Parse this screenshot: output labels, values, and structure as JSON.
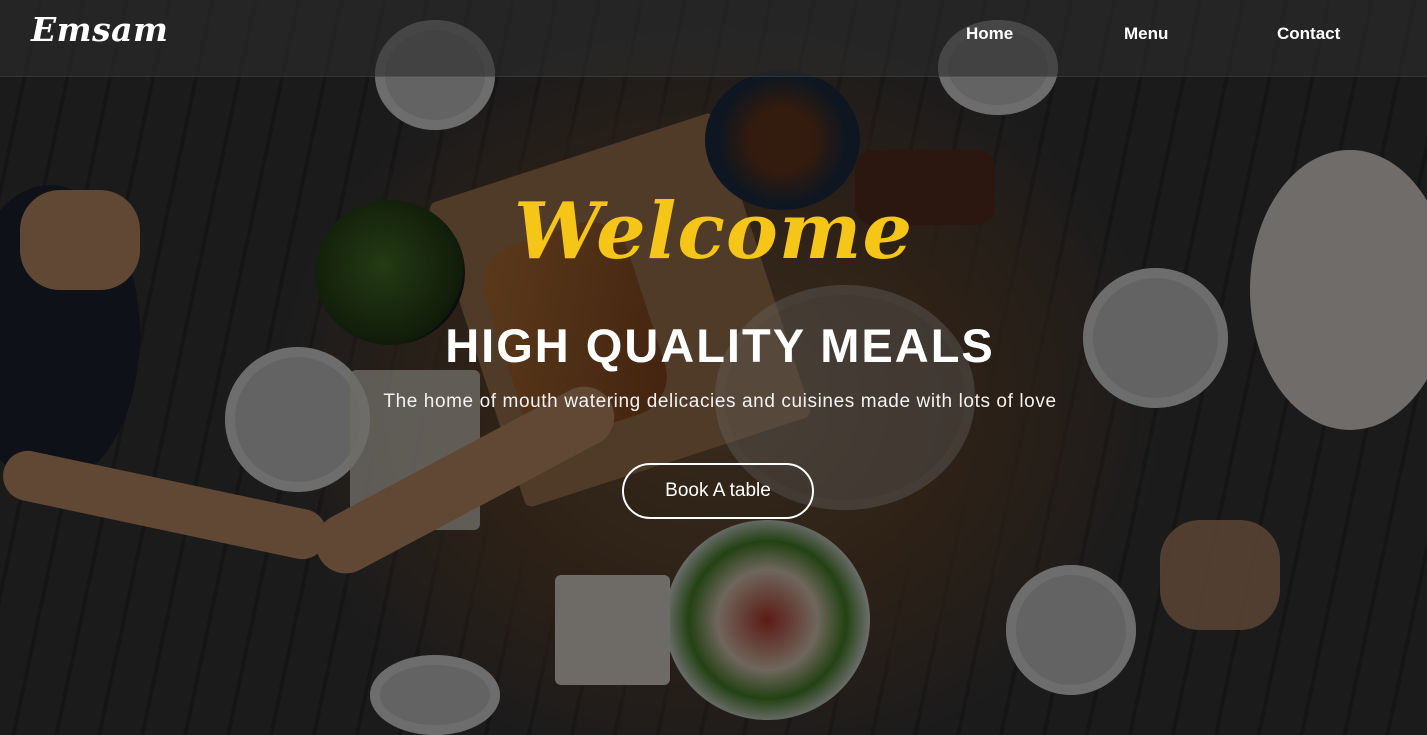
{
  "nav": {
    "brand": "Emsam",
    "links": [
      {
        "label": "Home"
      },
      {
        "label": "Menu"
      },
      {
        "label": "Contact"
      }
    ]
  },
  "hero": {
    "welcome": "Welcome",
    "headline": "HIGH QUALITY MEALS",
    "subline": "The home of mouth watering delicacies and cuisines made with lots of love",
    "cta_label": "Book A table"
  },
  "colors": {
    "accent": "#f5c518",
    "text": "#ffffff",
    "overlay": "rgba(0,0,0,0.52)"
  }
}
